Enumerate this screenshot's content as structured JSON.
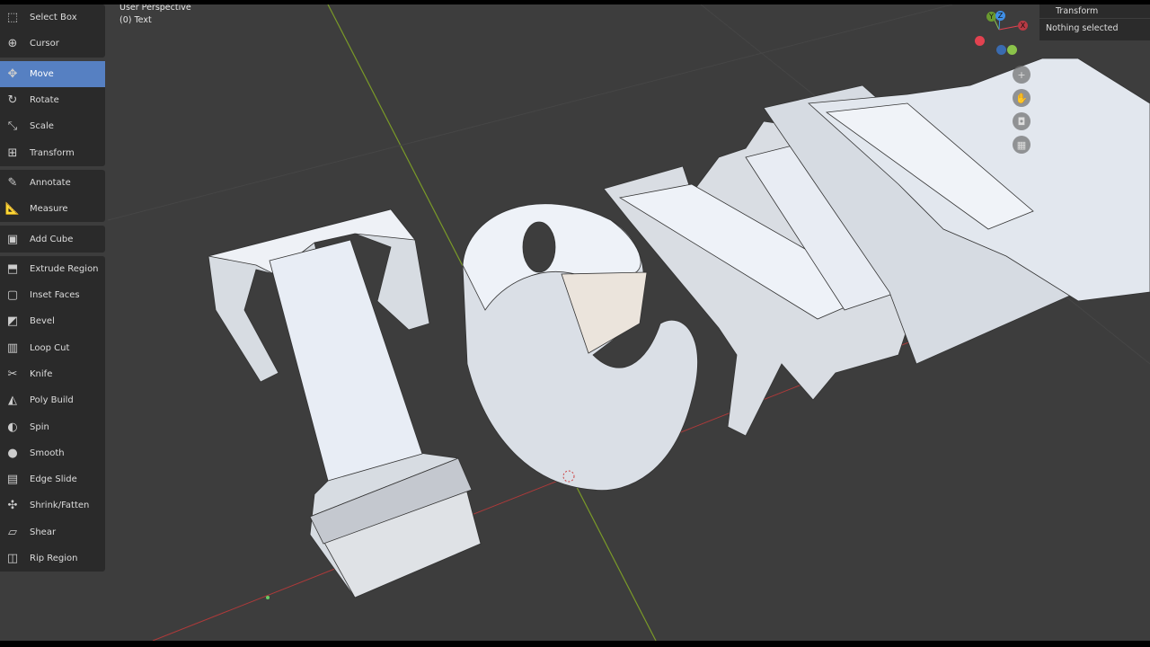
{
  "viewport": {
    "perspective_label": "User Perspective",
    "object_label": "(0) Text",
    "selection_status": "Nothing selected",
    "sidebar_tab": "Transform"
  },
  "gizmo": {
    "x": "X",
    "y": "Y",
    "z": "Z",
    "colors": {
      "x": "#e24250",
      "y": "#8bc34a",
      "z": "#3f8fe6"
    }
  },
  "toolbar": {
    "groups": [
      [
        {
          "label": "Select Box",
          "icon": "select-box"
        },
        {
          "label": "Cursor",
          "icon": "cursor"
        }
      ],
      [
        {
          "label": "Move",
          "icon": "move",
          "active": true
        },
        {
          "label": "Rotate",
          "icon": "rotate"
        },
        {
          "label": "Scale",
          "icon": "scale"
        },
        {
          "label": "Transform",
          "icon": "transform"
        }
      ],
      [
        {
          "label": "Annotate",
          "icon": "annotate"
        },
        {
          "label": "Measure",
          "icon": "measure"
        }
      ],
      [
        {
          "label": "Add Cube",
          "icon": "add-cube"
        }
      ],
      [
        {
          "label": "Extrude Region",
          "icon": "extrude"
        },
        {
          "label": "Inset Faces",
          "icon": "inset"
        },
        {
          "label": "Bevel",
          "icon": "bevel"
        },
        {
          "label": "Loop Cut",
          "icon": "loop-cut"
        },
        {
          "label": "Knife",
          "icon": "knife"
        },
        {
          "label": "Poly Build",
          "icon": "poly-build"
        },
        {
          "label": "Spin",
          "icon": "spin"
        },
        {
          "label": "Smooth",
          "icon": "smooth"
        },
        {
          "label": "Edge Slide",
          "icon": "edge-slide"
        },
        {
          "label": "Shrink/Fatten",
          "icon": "shrink-fatten"
        },
        {
          "label": "Shear",
          "icon": "shear"
        },
        {
          "label": "Rip Region",
          "icon": "rip-region"
        }
      ]
    ]
  },
  "colors": {
    "accent": "#5680c2",
    "background": "#3d3d3d"
  }
}
